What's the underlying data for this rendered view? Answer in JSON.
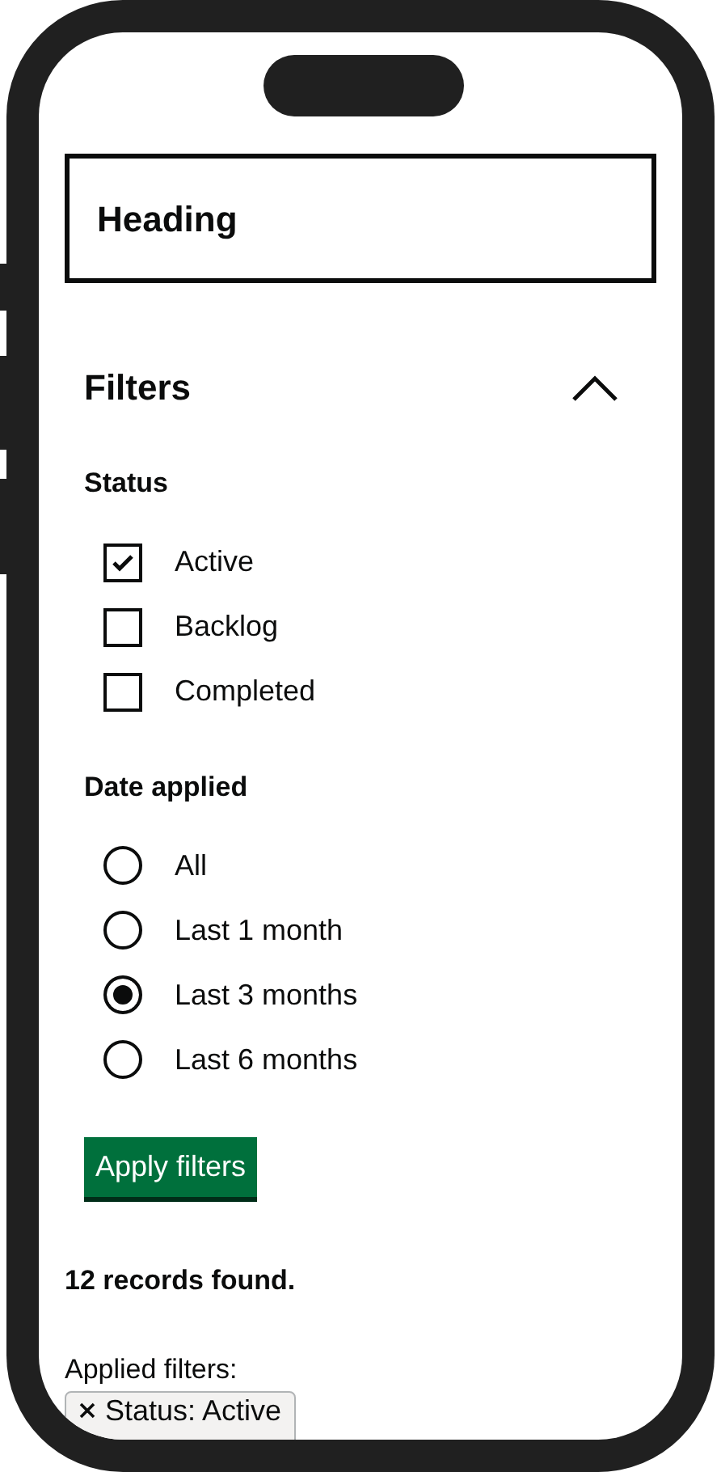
{
  "heading": "Heading",
  "filters": {
    "title": "Filters",
    "expanded": true,
    "groups": [
      {
        "kind": "checkbox",
        "legend": "Status",
        "options": [
          {
            "label": "Active",
            "checked": true
          },
          {
            "label": "Backlog",
            "checked": false
          },
          {
            "label": "Completed",
            "checked": false
          }
        ]
      },
      {
        "kind": "radio",
        "legend": "Date applied",
        "options": [
          {
            "label": "All",
            "selected": false
          },
          {
            "label": "Last 1 month",
            "selected": false
          },
          {
            "label": "Last 3 months",
            "selected": true
          },
          {
            "label": "Last 6 months",
            "selected": false
          }
        ]
      }
    ],
    "apply_button": "Apply filters"
  },
  "results_count": "12 records found.",
  "applied_filters": {
    "label": "Applied filters:",
    "tags": [
      "Status: Active"
    ]
  }
}
